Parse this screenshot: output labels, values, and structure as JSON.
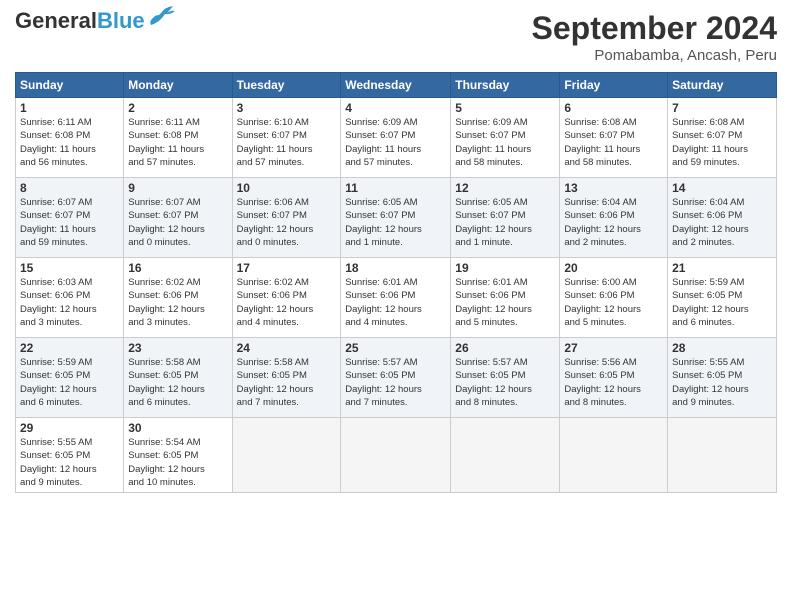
{
  "header": {
    "logo_general": "General",
    "logo_blue": "Blue",
    "month": "September 2024",
    "location": "Pomabamba, Ancash, Peru"
  },
  "days_of_week": [
    "Sunday",
    "Monday",
    "Tuesday",
    "Wednesday",
    "Thursday",
    "Friday",
    "Saturday"
  ],
  "weeks": [
    [
      {
        "day": 1,
        "info": "Sunrise: 6:11 AM\nSunset: 6:08 PM\nDaylight: 11 hours\nand 56 minutes."
      },
      {
        "day": 2,
        "info": "Sunrise: 6:11 AM\nSunset: 6:08 PM\nDaylight: 11 hours\nand 57 minutes."
      },
      {
        "day": 3,
        "info": "Sunrise: 6:10 AM\nSunset: 6:07 PM\nDaylight: 11 hours\nand 57 minutes."
      },
      {
        "day": 4,
        "info": "Sunrise: 6:09 AM\nSunset: 6:07 PM\nDaylight: 11 hours\nand 57 minutes."
      },
      {
        "day": 5,
        "info": "Sunrise: 6:09 AM\nSunset: 6:07 PM\nDaylight: 11 hours\nand 58 minutes."
      },
      {
        "day": 6,
        "info": "Sunrise: 6:08 AM\nSunset: 6:07 PM\nDaylight: 11 hours\nand 58 minutes."
      },
      {
        "day": 7,
        "info": "Sunrise: 6:08 AM\nSunset: 6:07 PM\nDaylight: 11 hours\nand 59 minutes."
      }
    ],
    [
      {
        "day": 8,
        "info": "Sunrise: 6:07 AM\nSunset: 6:07 PM\nDaylight: 11 hours\nand 59 minutes."
      },
      {
        "day": 9,
        "info": "Sunrise: 6:07 AM\nSunset: 6:07 PM\nDaylight: 12 hours\nand 0 minutes."
      },
      {
        "day": 10,
        "info": "Sunrise: 6:06 AM\nSunset: 6:07 PM\nDaylight: 12 hours\nand 0 minutes."
      },
      {
        "day": 11,
        "info": "Sunrise: 6:05 AM\nSunset: 6:07 PM\nDaylight: 12 hours\nand 1 minute."
      },
      {
        "day": 12,
        "info": "Sunrise: 6:05 AM\nSunset: 6:07 PM\nDaylight: 12 hours\nand 1 minute."
      },
      {
        "day": 13,
        "info": "Sunrise: 6:04 AM\nSunset: 6:06 PM\nDaylight: 12 hours\nand 2 minutes."
      },
      {
        "day": 14,
        "info": "Sunrise: 6:04 AM\nSunset: 6:06 PM\nDaylight: 12 hours\nand 2 minutes."
      }
    ],
    [
      {
        "day": 15,
        "info": "Sunrise: 6:03 AM\nSunset: 6:06 PM\nDaylight: 12 hours\nand 3 minutes."
      },
      {
        "day": 16,
        "info": "Sunrise: 6:02 AM\nSunset: 6:06 PM\nDaylight: 12 hours\nand 3 minutes."
      },
      {
        "day": 17,
        "info": "Sunrise: 6:02 AM\nSunset: 6:06 PM\nDaylight: 12 hours\nand 4 minutes."
      },
      {
        "day": 18,
        "info": "Sunrise: 6:01 AM\nSunset: 6:06 PM\nDaylight: 12 hours\nand 4 minutes."
      },
      {
        "day": 19,
        "info": "Sunrise: 6:01 AM\nSunset: 6:06 PM\nDaylight: 12 hours\nand 5 minutes."
      },
      {
        "day": 20,
        "info": "Sunrise: 6:00 AM\nSunset: 6:06 PM\nDaylight: 12 hours\nand 5 minutes."
      },
      {
        "day": 21,
        "info": "Sunrise: 5:59 AM\nSunset: 6:05 PM\nDaylight: 12 hours\nand 6 minutes."
      }
    ],
    [
      {
        "day": 22,
        "info": "Sunrise: 5:59 AM\nSunset: 6:05 PM\nDaylight: 12 hours\nand 6 minutes."
      },
      {
        "day": 23,
        "info": "Sunrise: 5:58 AM\nSunset: 6:05 PM\nDaylight: 12 hours\nand 6 minutes."
      },
      {
        "day": 24,
        "info": "Sunrise: 5:58 AM\nSunset: 6:05 PM\nDaylight: 12 hours\nand 7 minutes."
      },
      {
        "day": 25,
        "info": "Sunrise: 5:57 AM\nSunset: 6:05 PM\nDaylight: 12 hours\nand 7 minutes."
      },
      {
        "day": 26,
        "info": "Sunrise: 5:57 AM\nSunset: 6:05 PM\nDaylight: 12 hours\nand 8 minutes."
      },
      {
        "day": 27,
        "info": "Sunrise: 5:56 AM\nSunset: 6:05 PM\nDaylight: 12 hours\nand 8 minutes."
      },
      {
        "day": 28,
        "info": "Sunrise: 5:55 AM\nSunset: 6:05 PM\nDaylight: 12 hours\nand 9 minutes."
      }
    ],
    [
      {
        "day": 29,
        "info": "Sunrise: 5:55 AM\nSunset: 6:05 PM\nDaylight: 12 hours\nand 9 minutes."
      },
      {
        "day": 30,
        "info": "Sunrise: 5:54 AM\nSunset: 6:05 PM\nDaylight: 12 hours\nand 10 minutes."
      },
      null,
      null,
      null,
      null,
      null
    ]
  ]
}
